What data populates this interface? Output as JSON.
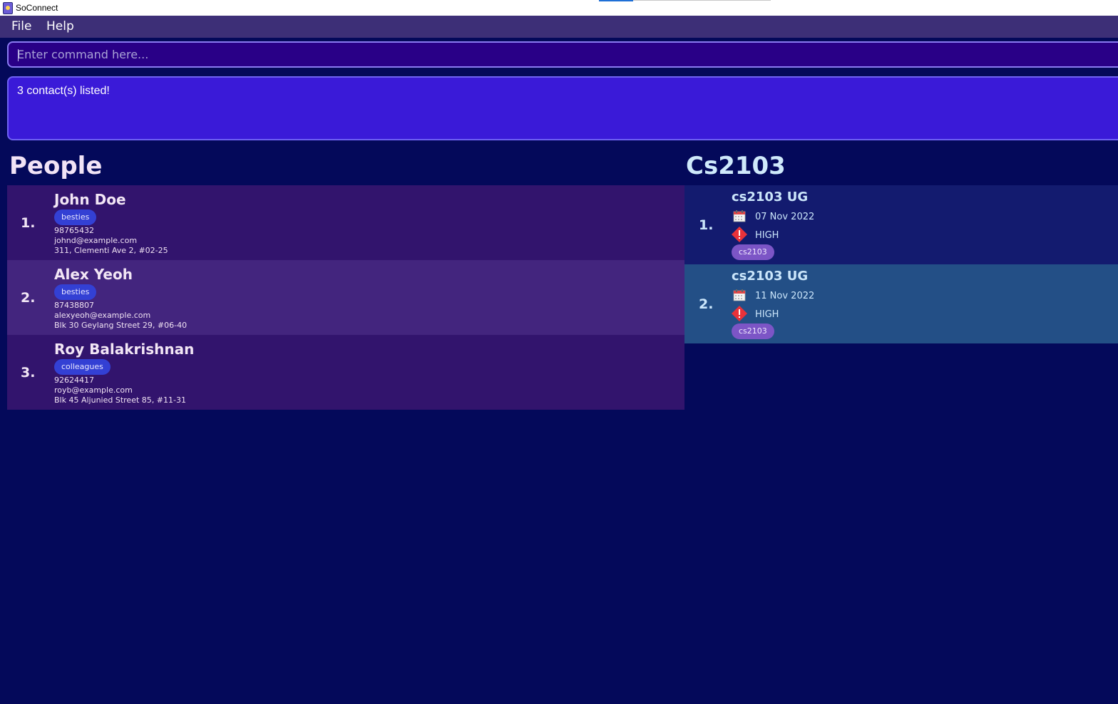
{
  "window": {
    "title": "SoConnect"
  },
  "menu": {
    "file": "File",
    "help": "Help"
  },
  "command": {
    "placeholder": "Enter command here..."
  },
  "result": {
    "message": "3 contact(s) listed!"
  },
  "people": {
    "title": "People",
    "items": [
      {
        "index": "1.",
        "name": "John Doe",
        "tag": "besties",
        "phone": "98765432",
        "email": "johnd@example.com",
        "address": "311, Clementi Ave 2, #02-25"
      },
      {
        "index": "2.",
        "name": "Alex Yeoh",
        "tag": "besties",
        "phone": "87438807",
        "email": "alexyeoh@example.com",
        "address": "Blk 30 Geylang Street 29, #06-40"
      },
      {
        "index": "3.",
        "name": "Roy Balakrishnan",
        "tag": "colleagues",
        "phone": "92624417",
        "email": "royb@example.com",
        "address": "Blk 45 Aljunied Street 85, #11-31"
      }
    ]
  },
  "tasks": {
    "title": "Cs2103",
    "items": [
      {
        "index": "1.",
        "name": "cs2103 UG",
        "date": "07 Nov 2022",
        "priority": "HIGH",
        "tag": "cs2103"
      },
      {
        "index": "2.",
        "name": "cs2103 UG",
        "date": "11 Nov 2022",
        "priority": "HIGH",
        "tag": "cs2103"
      }
    ]
  },
  "icons": {
    "calendar": "calendar-icon",
    "priority": "priority-high-icon",
    "app": "app-icon"
  },
  "colors": {
    "background": "#04095a",
    "menubar": "#3d2f77",
    "command_box": "#290087",
    "result_box": "#3a1ad8",
    "person_card_odd": "#32146d",
    "person_card_even": "#43257e",
    "task_card_1": "#131b6f",
    "task_card_selected": "#234f86",
    "priority_high": "#e8323a"
  }
}
